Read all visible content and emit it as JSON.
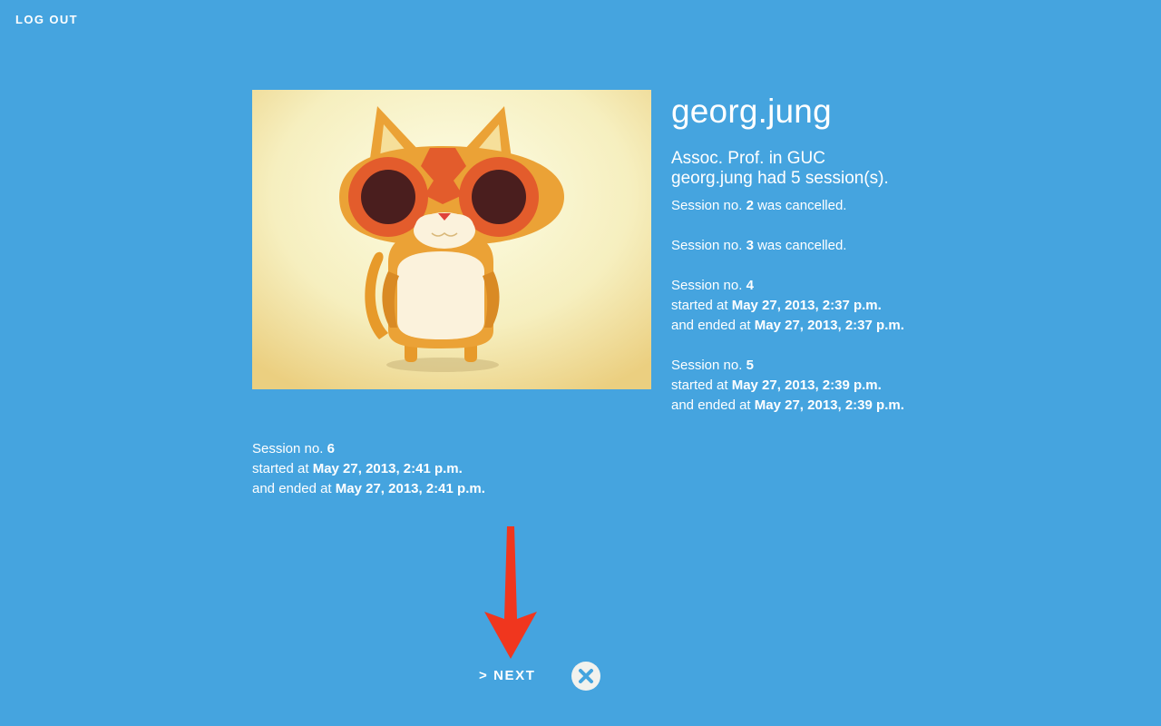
{
  "nav": {
    "logout_label": "LOG OUT"
  },
  "profile": {
    "username": "georg.jung",
    "role": "Assoc. Prof. in GUC",
    "summary": "georg.jung had 5 session(s)."
  },
  "sessions": [
    {
      "prefix": "Session no. ",
      "number": "2",
      "suffix": " was cancelled."
    },
    {
      "prefix": "Session no. ",
      "number": "3",
      "suffix": " was cancelled."
    },
    {
      "prefix": "Session no. ",
      "number": "4",
      "started_label": "started at ",
      "started": "May 27, 2013, 2:37 p.m.",
      "ended_label": "and ended at ",
      "ended": "May 27, 2013, 2:37 p.m."
    },
    {
      "prefix": "Session no. ",
      "number": "5",
      "started_label": "started at ",
      "started": "May 27, 2013, 2:39 p.m.",
      "ended_label": "and ended at ",
      "ended": "May 27, 2013, 2:39 p.m."
    },
    {
      "prefix": "Session no. ",
      "number": "6",
      "started_label": "started at ",
      "started": "May 27, 2013, 2:41 p.m.",
      "ended_label": "and ended at ",
      "ended": "May 27, 2013, 2:41 p.m."
    }
  ],
  "actions": {
    "next_label": "> NEXT",
    "close_icon": "close-icon"
  },
  "colors": {
    "background": "#45a4df",
    "arrow": "#f0361e",
    "close_bg": "#f2f2ee"
  }
}
